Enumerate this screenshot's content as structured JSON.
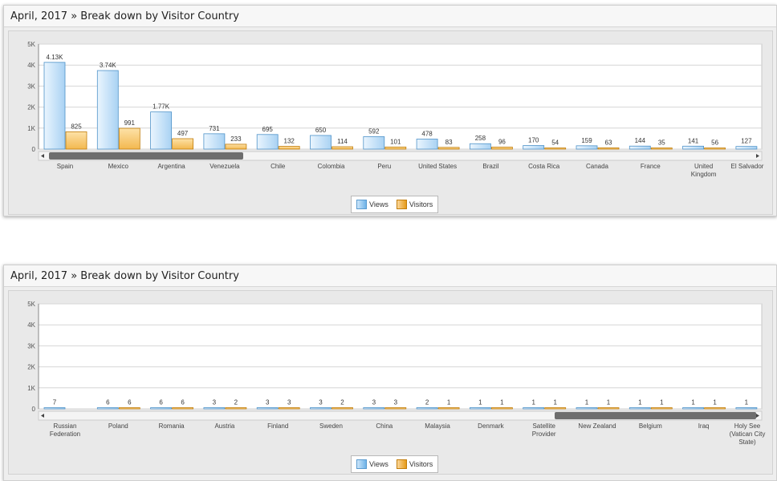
{
  "panels": [
    {
      "title": "April, 2017 » Break down by Visitor Country",
      "legend": {
        "views": "Views",
        "visitors": "Visitors"
      }
    },
    {
      "title": "April, 2017 » Break down by Visitor Country",
      "legend": {
        "views": "Views",
        "visitors": "Visitors"
      }
    }
  ],
  "colors": {
    "views": "#a9d2f3",
    "views_stroke": "#4f93c9",
    "visitors": "#f3b84f",
    "visitors_stroke": "#c27d0b"
  },
  "chart_data": [
    {
      "type": "bar",
      "title": "April, 2017 » Break down by Visitor Country",
      "ylim": [
        0,
        5000
      ],
      "yticks": [
        "0",
        "1K",
        "2K",
        "3K",
        "4K",
        "5K"
      ],
      "categories": [
        "Spain",
        "Mexico",
        "Argentina",
        "Venezuela",
        "Chile",
        "Colombia",
        "Peru",
        "United States",
        "Brazil",
        "Costa Rica",
        "Canada",
        "France",
        "United Kingdom",
        "El Salvador"
      ],
      "series": [
        {
          "name": "Views",
          "values": [
            4130,
            3740,
            1770,
            731,
            695,
            650,
            592,
            478,
            258,
            170,
            159,
            144,
            141,
            127
          ],
          "labels": [
            "4.13K",
            "3.74K",
            "1.77K",
            "731",
            "695",
            "650",
            "592",
            "478",
            "258",
            "170",
            "159",
            "144",
            "141",
            "127"
          ]
        },
        {
          "name": "Visitors",
          "values": [
            825,
            991,
            497,
            233,
            132,
            114,
            101,
            83,
            96,
            54,
            63,
            35,
            56,
            null
          ],
          "labels": [
            "825",
            "991",
            "497",
            "233",
            "132",
            "114",
            "101",
            "83",
            "96",
            "54",
            "63",
            "35",
            "56",
            ""
          ]
        }
      ],
      "grid": true,
      "legend_position": "bottom-center"
    },
    {
      "type": "bar",
      "title": "April, 2017 » Break down by Visitor Country",
      "ylim": [
        0,
        5000
      ],
      "yticks": [
        "0",
        "1K",
        "2K",
        "3K",
        "4K",
        "5K"
      ],
      "categories": [
        "Russian Federation",
        "Poland",
        "Romania",
        "Austria",
        "Finland",
        "Sweden",
        "China",
        "Malaysia",
        "Denmark",
        "Satellite Provider",
        "New Zealand",
        "Belgium",
        "Iraq",
        "Holy See (Vatican City State)"
      ],
      "series": [
        {
          "name": "Views",
          "values": [
            7,
            6,
            6,
            3,
            3,
            3,
            3,
            2,
            1,
            1,
            1,
            1,
            1,
            1
          ],
          "labels": [
            "7",
            "6",
            "6",
            "3",
            "3",
            "3",
            "3",
            "2",
            "1",
            "1",
            "1",
            "1",
            "1",
            "1"
          ]
        },
        {
          "name": "Visitors",
          "values": [
            null,
            6,
            6,
            2,
            3,
            2,
            3,
            1,
            1,
            1,
            1,
            1,
            1,
            1
          ],
          "labels": [
            "",
            "6",
            "6",
            "2",
            "3",
            "2",
            "3",
            "1",
            "1",
            "1",
            "1",
            "1",
            "1",
            "1"
          ]
        }
      ],
      "grid": true,
      "legend_position": "bottom-center"
    }
  ]
}
